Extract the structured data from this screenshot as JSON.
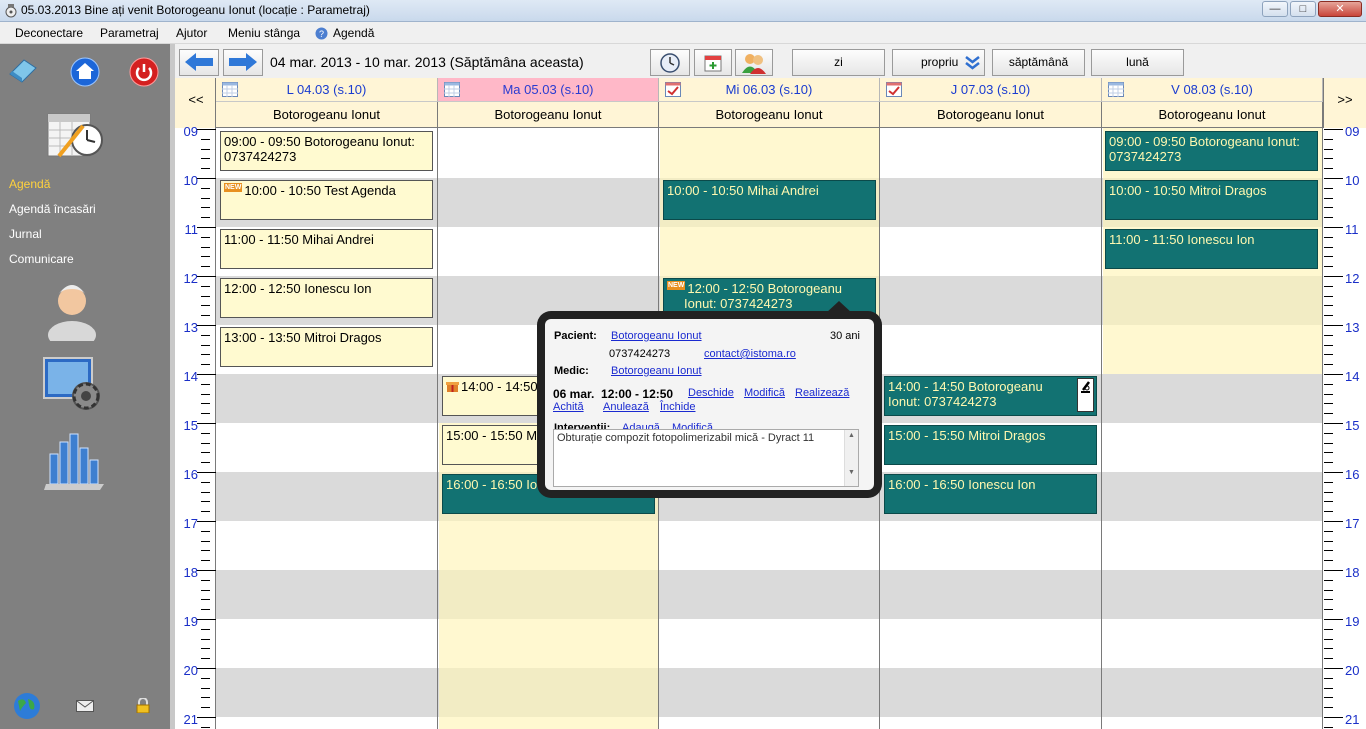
{
  "window": {
    "title": "05.03.2013 Bine ați venit Botorogeanu Ionut (locație : Parametraj)"
  },
  "menu": {
    "items": [
      "Deconectare",
      "Parametraj",
      "Ajutor",
      "Meniu stânga",
      "Agendă"
    ]
  },
  "sidebar": {
    "links": [
      "Agendă",
      "Agendă încasări",
      "Jurnal",
      "Comunicare"
    ],
    "active": "Agendă"
  },
  "toolbar": {
    "date_range": "04 mar. 2013 - 10 mar. 2013 (Săptămâna aceasta)",
    "view_zi": "zi",
    "view_propriu": "propriu",
    "view_saptamana": "săptămână",
    "view_luna": "lună"
  },
  "calendar": {
    "prev": "<<",
    "next": ">>",
    "days": [
      {
        "label": "L 04.03 (s.10)",
        "doctor": "Botorogeanu Ionut"
      },
      {
        "label": "Ma 05.03 (s.10)",
        "doctor": "Botorogeanu Ionut"
      },
      {
        "label": "Mi 06.03 (s.10)",
        "doctor": "Botorogeanu Ionut"
      },
      {
        "label": "J 07.03 (s.10)",
        "doctor": "Botorogeanu Ionut"
      },
      {
        "label": "V 08.03 (s.10)",
        "doctor": "Botorogeanu Ionut"
      }
    ],
    "hours": [
      "09",
      "10",
      "11",
      "12",
      "13",
      "14",
      "15",
      "16",
      "17",
      "18",
      "19",
      "20",
      "21"
    ],
    "appointments": {
      "mon": [
        "09:00 - 09:50  Botorogeanu Ionut: 0737424273",
        "10:00 - 10:50  Test Agenda",
        "11:00 - 11:50  Mihai Andrei",
        "12:00 - 12:50  Ionescu Ion",
        "13:00 - 13:50  Mitroi Dragos"
      ],
      "tue": [
        "14:00 - 14:50",
        "15:00 - 15:50  M",
        "16:00 - 16:50  Io"
      ],
      "wed": [
        "10:00 - 10:50  Mihai Andrei",
        "12:00 - 12:50  Botorogeanu Ionut: 0737424273"
      ],
      "thu": [
        "14:00 - 14:50  Botorogeanu Ionut: 0737424273",
        "15:00 - 15:50  Mitroi Dragos",
        "16:00 - 16:50  Ionescu Ion"
      ],
      "fri": [
        "09:00 - 09:50  Botorogeanu Ionut: 0737424273",
        "10:00 - 10:50  Mitroi Dragos",
        "11:00 - 11:50  Ionescu Ion"
      ]
    },
    "new_tag": "NEW"
  },
  "popup": {
    "pacient_label": "Pacient:",
    "pacient_name": "Botorogeanu Ionut",
    "age": "30 ani",
    "phone": "0737424273",
    "email": "contact@istoma.ro",
    "medic_label": "Medic:",
    "medic_name": "Botorogeanu Ionut",
    "datetime": "06 mar.  12:00 - 12:50",
    "actions": [
      "Deschide",
      "Modifică",
      "Realizează",
      "Achită",
      "Anulează",
      "Închide"
    ],
    "interventii_label": "Intervenții:",
    "interventii_add": "Adaugă",
    "interventii_edit": "Modifică",
    "notes": "Obturație compozit fotopolimerizabil mică - Dyract 11"
  }
}
